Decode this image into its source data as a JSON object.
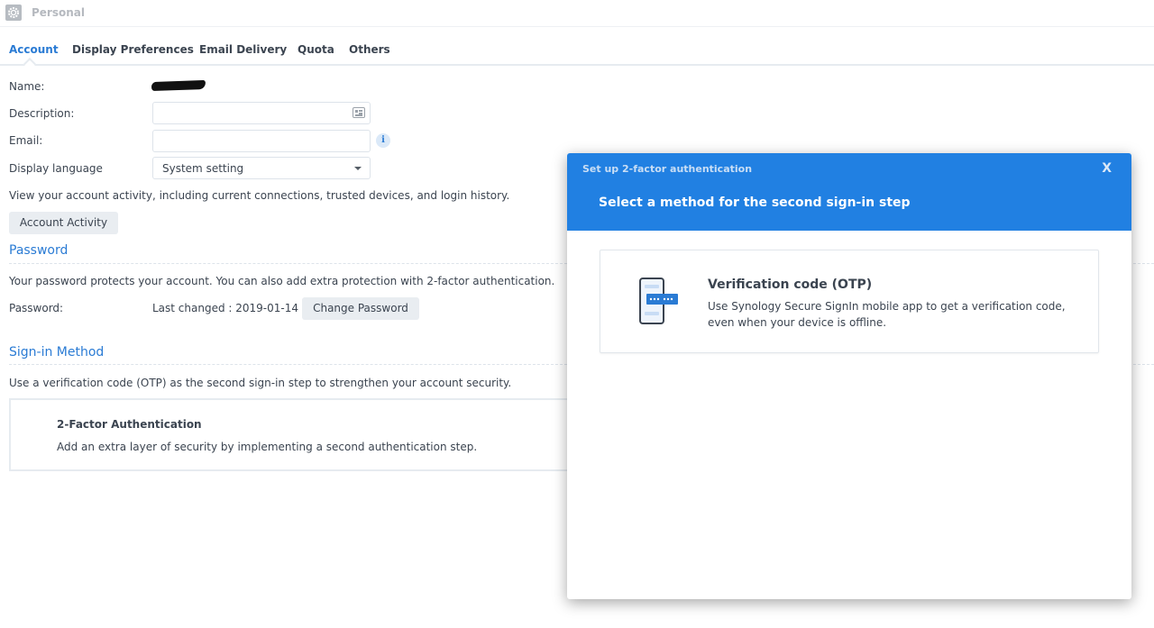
{
  "window": {
    "title": "Personal",
    "icon": "settings-gear-icon"
  },
  "tabs": [
    {
      "label": "Account",
      "active": true
    },
    {
      "label": "Display Preferences",
      "active": false
    },
    {
      "label": "Email Delivery",
      "active": false
    },
    {
      "label": "Quota",
      "active": false
    },
    {
      "label": "Others",
      "active": false
    }
  ],
  "account": {
    "name_label": "Name:",
    "name_value": "[redacted]",
    "description_label": "Description:",
    "description_value": "",
    "email_label": "Email:",
    "email_value": "",
    "display_language_label": "Display language",
    "display_language_value": "System setting",
    "activity_text": "View your account activity, including current connections, trusted devices, and login history.",
    "activity_button": "Account Activity"
  },
  "password": {
    "section_title": "Password",
    "description": "Your password protects your account. You can also add extra protection with 2-factor authentication.",
    "label": "Password:",
    "last_changed": "Last changed : 2019-01-14",
    "change_button": "Change Password"
  },
  "signin": {
    "section_title": "Sign-in Method",
    "description": "Use a verification code (OTP) as the second sign-in step to strengthen your account security.",
    "tfa_title": "2-Factor Authentication",
    "tfa_desc": "Add an extra layer of security by implementing a second authentication step."
  },
  "dialog": {
    "small_title": "Set up 2-factor authentication",
    "close_label": "X",
    "big_title": "Select a method for the second sign-in step",
    "methods": [
      {
        "title": "Verification code (OTP)",
        "description": "Use Synology Secure SignIn mobile app to get a verification code, even when your device is offline.",
        "icon": "phone-otp-icon"
      }
    ]
  },
  "colors": {
    "accent": "#2a7bd4",
    "dialog_header": "#2180e2",
    "text": "#3b4450"
  }
}
